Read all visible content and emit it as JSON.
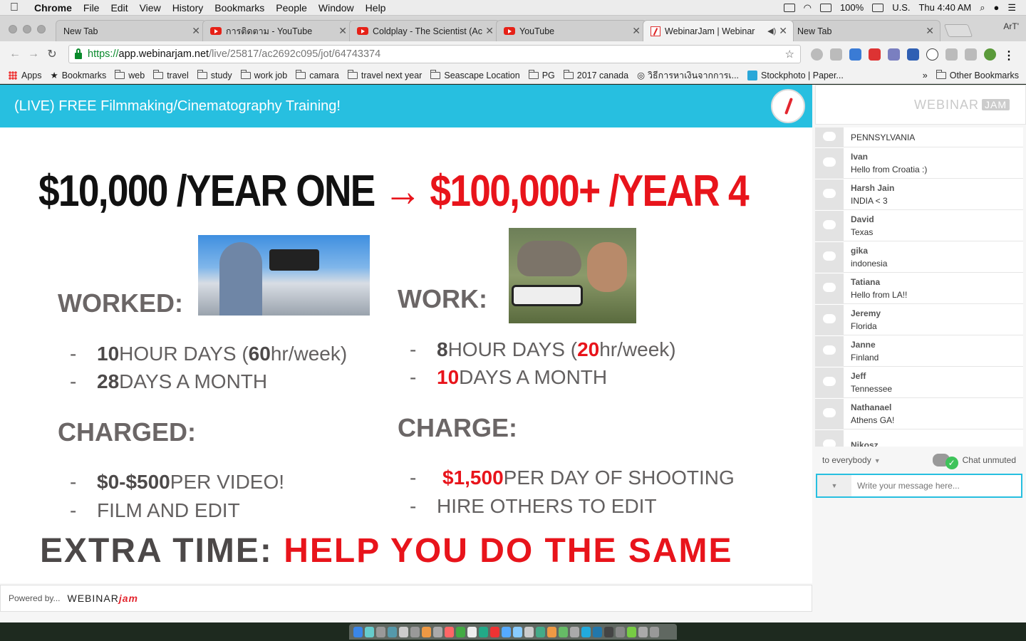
{
  "menubar": {
    "app": "Chrome",
    "items": [
      "File",
      "Edit",
      "View",
      "History",
      "Bookmarks",
      "People",
      "Window",
      "Help"
    ],
    "battery": "100%",
    "input_source": "U.S.",
    "clock": "Thu 4:40 AM"
  },
  "tabs": [
    {
      "title": "New Tab",
      "icon": "none",
      "active": false
    },
    {
      "title": "การติดตาม - YouTube",
      "icon": "youtube-icon",
      "active": false
    },
    {
      "title": "Coldplay - The Scientist (Ac",
      "icon": "youtube-icon",
      "active": false
    },
    {
      "title": "YouTube",
      "icon": "youtube-icon",
      "active": false
    },
    {
      "title": "WebinarJam | Webinar",
      "icon": "webinarjam-icon",
      "active": true
    },
    {
      "title": "New Tab",
      "icon": "none",
      "active": false
    }
  ],
  "profile_name": "ArT'",
  "address": {
    "scheme": "https://",
    "host": "app.webinarjam.net",
    "path": "/live/25817/ac2692c095/jot/64743374"
  },
  "bookmarks": {
    "apps": "Apps",
    "items": [
      "Bookmarks",
      "web",
      "travel",
      "study",
      "work job",
      "camara",
      "travel next year",
      "Seascape Location",
      "PG",
      "2017 canada",
      "วิธีการหาเงินจากการเ...",
      "Stockphoto | Paper..."
    ],
    "other": "Other Bookmarks"
  },
  "webinar": {
    "title": "(LIVE) FREE Filmmaking/Cinematography Training!",
    "brand": "WEBINAR",
    "brand_tag": "JAM",
    "powered_by": "Powered by...",
    "powered_logo": "WEBINAR",
    "powered_logo_accent": "jam"
  },
  "slide": {
    "headline_left": "$10,000 /YEAR ONE",
    "arrow": "→",
    "headline_right": "$100,000+ /YEAR 4",
    "worked_label": "WORKED:",
    "work_label": "WORK:",
    "worked_items": [
      {
        "num": "10",
        "pre": " HOUR DAYS (",
        "num2": "60",
        "post": "hr/week)"
      },
      {
        "num": "28",
        "post": " DAYS A MONTH"
      }
    ],
    "work_items": [
      {
        "num": "8",
        "pre": " HOUR DAYS (",
        "num2": "20",
        "post": "hr/week)"
      },
      {
        "num": "10",
        "post": " DAYS A MONTH"
      }
    ],
    "charged_label": "CHARGED:",
    "charge_label": "CHARGE:",
    "charged_items": [
      {
        "num": "$0-$500",
        "post": " PER VIDEO!"
      },
      {
        "post": "FILM AND EDIT"
      }
    ],
    "charge_items": [
      {
        "num": "$1,500",
        "post": " PER DAY OF SHOOTING"
      },
      {
        "post": "HIRE OTHERS TO EDIT"
      }
    ],
    "extra_label": "EXTRA TIME:",
    "extra_value": "HELP YOU DO THE SAME"
  },
  "chat": {
    "messages": [
      {
        "name": "",
        "text": "PENNSYLVANIA"
      },
      {
        "name": "Ivan",
        "text": "Hello from Croatia :)"
      },
      {
        "name": "Harsh Jain",
        "text": "INDIA < 3"
      },
      {
        "name": "David",
        "text": "Texas"
      },
      {
        "name": "gika",
        "text": "indonesia"
      },
      {
        "name": "Tatiana",
        "text": "Hello from LA!!"
      },
      {
        "name": "Jeremy",
        "text": "Florida"
      },
      {
        "name": "Janne",
        "text": "Finland"
      },
      {
        "name": "Jeff",
        "text": "Tennessee"
      },
      {
        "name": "Nathanael",
        "text": "Athens GA!"
      },
      {
        "name": "Nikosz",
        "text": ""
      }
    ],
    "audience": "to everybody",
    "mute_status": "Chat unmuted",
    "input_placeholder": "Write your message here..."
  },
  "colors": {
    "banner": "#27bfe0",
    "red": "#e8141b"
  }
}
